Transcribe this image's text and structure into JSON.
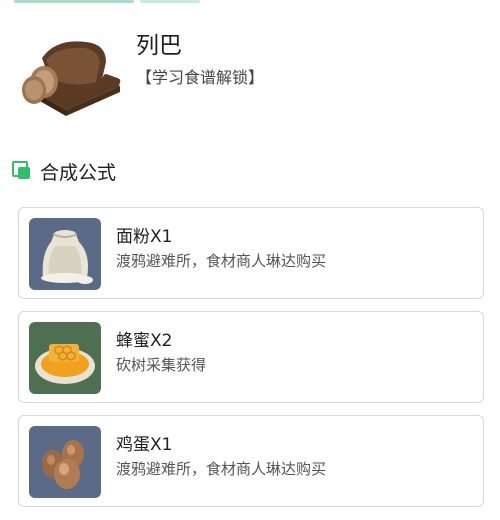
{
  "item": {
    "name": "列巴",
    "unlock_note": "【学习食谱解锁】",
    "image_icon": "bread-loaf-icon"
  },
  "section": {
    "title": "合成公式",
    "icon": "formula-icon",
    "accent_color": "#2fbf6b"
  },
  "ingredients": [
    {
      "name": "面粉X1",
      "source": "渡鸦避难所，食材商人琳达购买",
      "icon": "flour-sack-icon"
    },
    {
      "name": "蜂蜜X2",
      "source": "砍树采集获得",
      "icon": "honeycomb-icon"
    },
    {
      "name": "鸡蛋X1",
      "source": "渡鸦避难所，食材商人琳达购买",
      "icon": "eggs-icon"
    }
  ]
}
